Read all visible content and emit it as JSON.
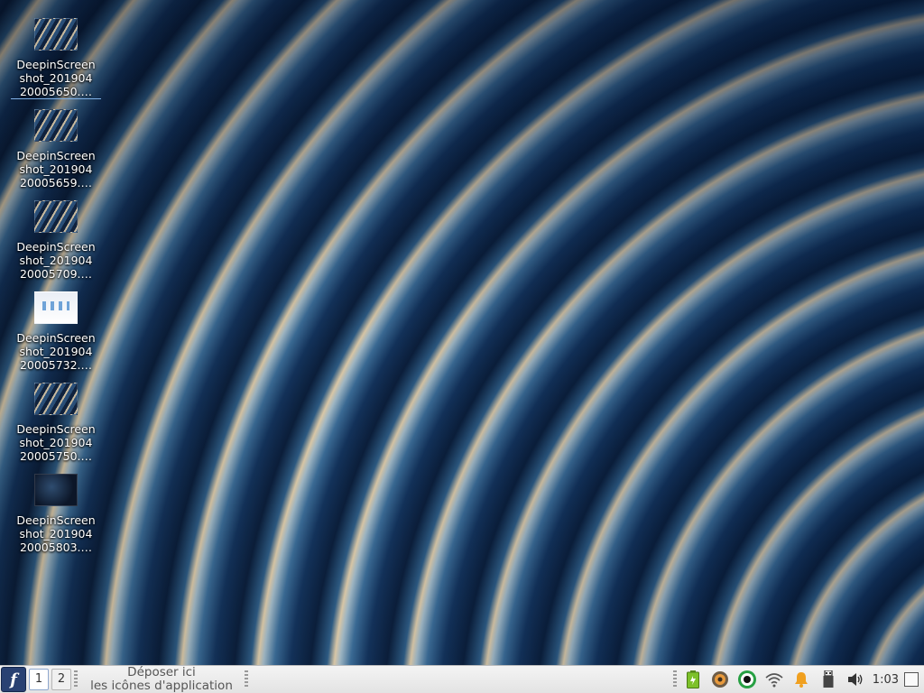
{
  "desktop": {
    "icons": [
      {
        "label": "DeepinScreenshot_20190420005650.…",
        "thumb": "dark-curves"
      },
      {
        "label": "DeepinScreenshot_20190420005659.…",
        "thumb": "dark-curves"
      },
      {
        "label": "DeepinScreenshot_20190420005709.…",
        "thumb": "dark-curves"
      },
      {
        "label": "DeepinScreenshot_20190420005732.…",
        "thumb": "light-window"
      },
      {
        "label": "DeepinScreenshot_20190420005750.…",
        "thumb": "dark-curves"
      },
      {
        "label": "DeepinScreenshot_20190420005803.…",
        "thumb": "dark-blue"
      }
    ],
    "icon_lines": [
      [
        "DeepinScreen",
        "shot_201904",
        "20005650.…"
      ],
      [
        "DeepinScreen",
        "shot_201904",
        "20005659.…"
      ],
      [
        "DeepinScreen",
        "shot_201904",
        "20005709.…"
      ],
      [
        "DeepinScreen",
        "shot_201904",
        "20005732.…"
      ],
      [
        "DeepinScreen",
        "shot_201904",
        "20005750.…"
      ],
      [
        "DeepinScreen",
        "shot_201904",
        "20005803.…"
      ]
    ]
  },
  "taskbar": {
    "start_icon": "fedora-logo-icon",
    "workspaces": [
      "1",
      "2"
    ],
    "active_workspace": "1",
    "app_drop_line1": "Déposer ici",
    "app_drop_line2": "les icônes d'application",
    "tray_icons": [
      "battery-icon",
      "hexchat-icon",
      "record-icon",
      "wifi-icon",
      "notification-bell-icon",
      "usb-icon",
      "volume-icon"
    ],
    "clock": "1:03",
    "show_desktop_icon": "show-desktop-icon"
  },
  "colors": {
    "panel_bg": "#e9e9e9",
    "start_bg": "#294172",
    "battery": "#7dc12a",
    "record_ring": "#27a043",
    "bell": "#f0a020"
  }
}
